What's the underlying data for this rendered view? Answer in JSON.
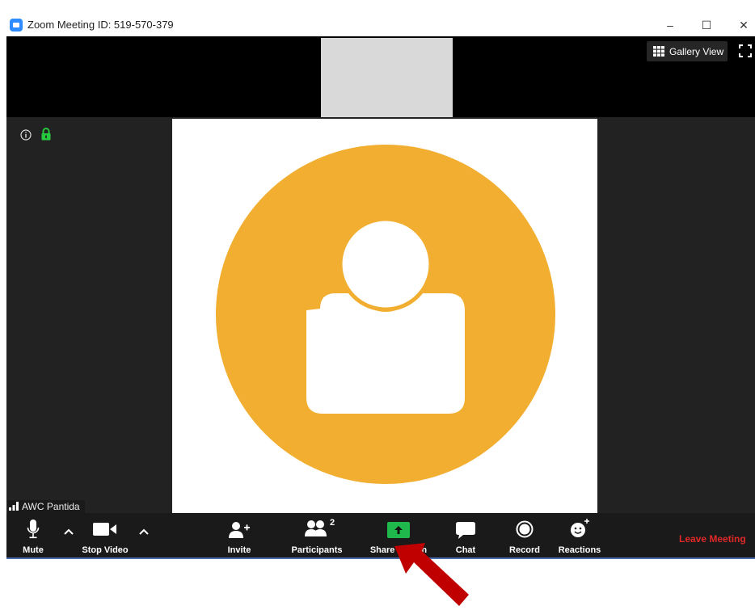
{
  "window": {
    "title": "Zoom Meeting ID: 519-570-379",
    "controls": {
      "minimize": "–",
      "maximize": "☐",
      "close": "✕"
    }
  },
  "header": {
    "gallery_view_label": "Gallery View"
  },
  "video": {
    "participant_name": "AWC Pantida",
    "avatar_color": "#f2ae30"
  },
  "toolbar": {
    "mute_label": "Mute",
    "stop_video_label": "Stop Video",
    "invite_label": "Invite",
    "participants_label": "Participants",
    "participants_count": "2",
    "share_screen_label": "Share Screen",
    "chat_label": "Chat",
    "record_label": "Record",
    "reactions_label": "Reactions",
    "leave_label": "Leave Meeting"
  },
  "colors": {
    "share_green": "#1fb84c",
    "leave_red": "#e02828",
    "arrow_red": "#c00000"
  }
}
